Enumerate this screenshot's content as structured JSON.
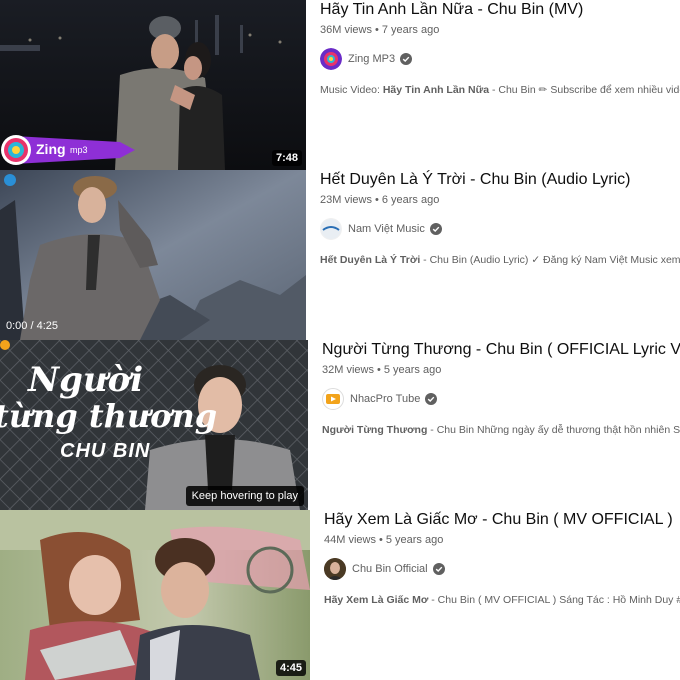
{
  "videos": [
    {
      "title": "Hãy Tin Anh Lần Nữa - Chu Bin (MV)",
      "views": "36M views",
      "age": "7 years ago",
      "channel": "Zing MP3",
      "channel_icon": "zing-mp3-avatar",
      "desc_prefix": "Music Video: ",
      "desc_bold": "Hãy Tin Anh Lần Nữa",
      "desc_rest": " - Chu Bin ✏ Subscribe để xem nhiều video hay",
      "duration": "7:48",
      "thumb_logo_text": "Zing",
      "thumb_logo_sub": "mp3"
    },
    {
      "title": "Hết Duyên Là Ý Trời - Chu Bin (Audio Lyric)",
      "views": "23M views",
      "age": "6 years ago",
      "channel": "Nam Việt Music",
      "channel_icon": "nam-viet-avatar",
      "desc_prefix": "",
      "desc_bold": "Hết Duyên Là Ý Trời",
      "desc_rest": " - Chu Bin (Audio Lyric) ✓ Đăng ký Nam Việt Music xem ngay",
      "progress": "0:00 / 4:25"
    },
    {
      "title": "Người Từng Thương - Chu Bin ( OFFICIAL Lyric Video )",
      "views": "32M views",
      "age": "5 years ago",
      "channel": "NhacPro Tube",
      "channel_icon": "nhacpro-avatar",
      "desc_prefix": "",
      "desc_bold": "Người Từng Thương",
      "desc_rest": " - Chu Bin Những ngày ấy dễ thương thật hồn nhiên Sao em",
      "hover_text": "Keep hovering to play",
      "thumb_line1": "Người",
      "thumb_line2": "từng thương",
      "thumb_artist": "CHU BIN"
    },
    {
      "title": "Hãy Xem Là Giấc Mơ - Chu Bin ( MV OFFICIAL )",
      "views": "44M views",
      "age": "5 years ago",
      "channel": "Chu Bin Official",
      "channel_icon": "chu-bin-avatar",
      "desc_prefix": "",
      "desc_bold": "Hãy Xem Là Giấc Mơ",
      "desc_rest": " - Chu Bin ( MV OFFICIAL ) Sáng Tác : Hồ Minh Duy #hay",
      "duration": "4:45"
    }
  ],
  "dot": "•"
}
